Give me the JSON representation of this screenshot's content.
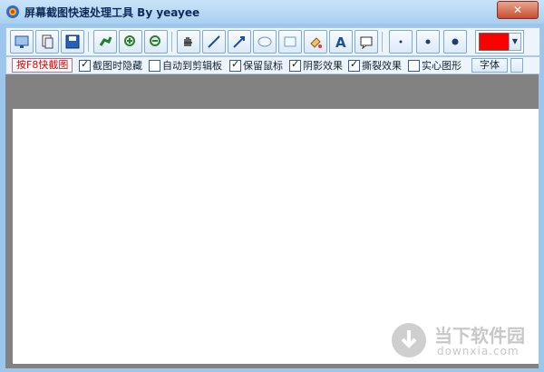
{
  "window": {
    "title": "屏幕截图快速处理工具 By yeayee",
    "close_label": "✕"
  },
  "toolbar": {
    "buttons": [
      {
        "name": "capture-icon",
        "label": ""
      },
      {
        "name": "copy-icon",
        "label": ""
      },
      {
        "name": "save-icon",
        "label": ""
      },
      {
        "name": "rotate-icon",
        "label": ""
      },
      {
        "name": "zoom-in-icon",
        "label": ""
      },
      {
        "name": "zoom-out-icon",
        "label": ""
      },
      {
        "name": "hand-icon",
        "label": ""
      },
      {
        "name": "line-icon",
        "label": ""
      },
      {
        "name": "arrow-icon",
        "label": ""
      },
      {
        "name": "ellipse-icon",
        "label": ""
      },
      {
        "name": "rectangle-icon",
        "label": ""
      },
      {
        "name": "paint-bucket-icon",
        "label": ""
      },
      {
        "name": "text-icon",
        "label": "A"
      },
      {
        "name": "note-icon",
        "label": ""
      }
    ],
    "sizes": [
      "small",
      "medium",
      "large"
    ],
    "color": "#ff0000"
  },
  "options": {
    "capture_button": "按F8快截图",
    "items": [
      {
        "label": "截图时隐藏",
        "checked": true
      },
      {
        "label": "自动到剪辑板",
        "checked": false
      },
      {
        "label": "保留鼠标",
        "checked": true
      },
      {
        "label": "阴影效果",
        "checked": true
      },
      {
        "label": "撕裂效果",
        "checked": true
      },
      {
        "label": "实心图形",
        "checked": false
      }
    ],
    "font_button": "字体"
  },
  "watermark": {
    "name": "当下软件园",
    "url": "downxia.com"
  }
}
